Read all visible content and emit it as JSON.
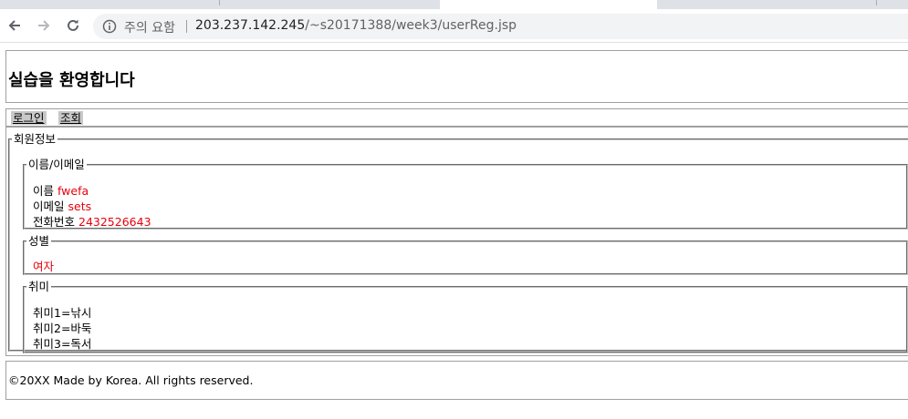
{
  "browser": {
    "url_warning": "주의 요함",
    "url_host": "203.237.142.245",
    "url_path": "/~s20171388/week3/userReg.jsp"
  },
  "header": {
    "title": "실습을 환영합니다"
  },
  "nav": {
    "login_label": "로그인",
    "view_label": "조회"
  },
  "member_info": {
    "legend": "회원정보",
    "name_email": {
      "legend": "이름/이메일",
      "name_label": "이름",
      "name_value": "fwefa",
      "email_label": "이메일",
      "email_value": "sets",
      "phone_label": "전화번호",
      "phone_value": "2432526643"
    },
    "gender": {
      "legend": "성별",
      "value": "여자"
    },
    "hobby": {
      "legend": "취미",
      "items": [
        "취미1=낚시",
        "취미2=바둑",
        "취미3=독서"
      ]
    }
  },
  "footer": {
    "text": "©20XX Made by Korea. All rights reserved."
  },
  "colors": {
    "value_text": "#e8000c",
    "link_bg": "#c8c8c8",
    "omnibox_bg": "#f1f3f4"
  }
}
